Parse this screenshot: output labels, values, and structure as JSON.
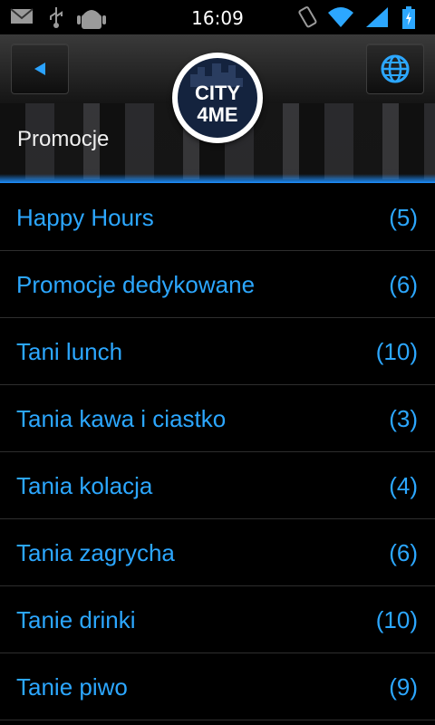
{
  "status_bar": {
    "time": "16:09",
    "icons": [
      "gmail-icon",
      "usb-icon",
      "android-debug-icon",
      "vibrate-icon",
      "wifi-icon",
      "signal-icon",
      "battery-charging-icon"
    ]
  },
  "header": {
    "title": "Promocje",
    "logo_text_top": "CITY",
    "logo_text_bottom": "4ME",
    "back_icon": "back-arrow-icon",
    "globe_icon": "globe-icon"
  },
  "categories": [
    {
      "label": "Happy Hours",
      "count": "(5)"
    },
    {
      "label": "Promocje dedykowane",
      "count": "(6)"
    },
    {
      "label": "Tani lunch",
      "count": "(10)"
    },
    {
      "label": "Tania kawa i ciastko",
      "count": "(3)"
    },
    {
      "label": "Tania kolacja",
      "count": "(4)"
    },
    {
      "label": "Tania zagrycha",
      "count": "(6)"
    },
    {
      "label": "Tanie drinki",
      "count": "(10)"
    },
    {
      "label": "Tanie piwo",
      "count": "(9)"
    }
  ],
  "colors": {
    "accent": "#2ca7ff",
    "background": "#000000"
  }
}
